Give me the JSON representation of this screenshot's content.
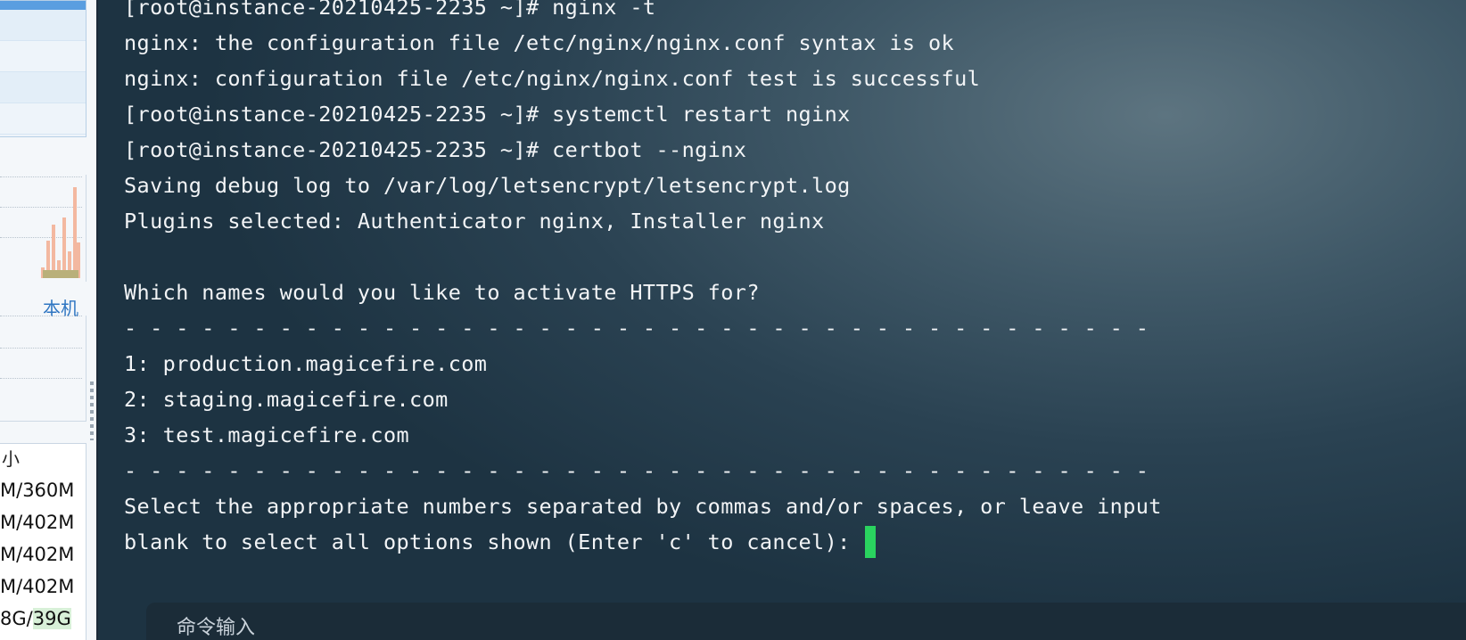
{
  "sidebar": {
    "local_label": "本机",
    "size_header": "小",
    "sizes": [
      "M/360M",
      "M/402M",
      "M/402M",
      "M/402M"
    ],
    "disk_used": "8G/",
    "disk_total": "39G"
  },
  "terminal": {
    "lines": [
      "[root@instance-20210425-2235 ~]# nginx -t",
      "nginx: the configuration file /etc/nginx/nginx.conf syntax is ok",
      "nginx: configuration file /etc/nginx/nginx.conf test is successful",
      "[root@instance-20210425-2235 ~]# systemctl restart nginx",
      "[root@instance-20210425-2235 ~]# certbot --nginx",
      "Saving debug log to /var/log/letsencrypt/letsencrypt.log",
      "Plugins selected: Authenticator nginx, Installer nginx",
      "",
      "Which names would you like to activate HTTPS for?",
      "- - - - - - - - - - - - - - - - - - - - - - - - - - - - - - - - - - - - - - - -",
      "1: production.magicefire.com",
      "2: staging.magicefire.com",
      "3: test.magicefire.com",
      "- - - - - - - - - - - - - - - - - - - - - - - - - - - - - - - - - - - - - - - -",
      "Select the appropriate numbers separated by commas and/or spaces, or leave input"
    ],
    "prompt_line": "blank to select all options shown (Enter 'c' to cancel): ",
    "cursor_color": "#2ad35f"
  },
  "command_input": {
    "label": "命令输入"
  }
}
